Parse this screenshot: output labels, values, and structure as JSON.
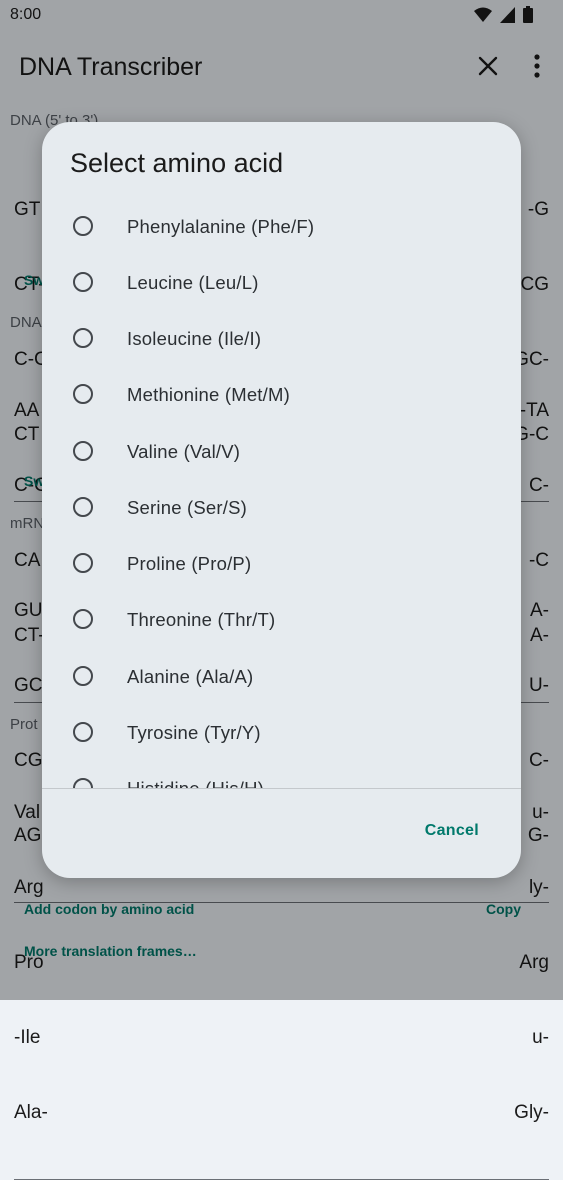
{
  "status_bar": {
    "time": "8:00"
  },
  "app_bar": {
    "title": "DNA Transcriber"
  },
  "sections": [
    {
      "label": "DNA (5' to 3')",
      "lines": [
        [
          "GT",
          "-G"
        ],
        [
          "CT-",
          "CG"
        ],
        [
          "C-C",
          "GC-"
        ],
        [
          "CT",
          "G-C"
        ]
      ],
      "link": "Sw"
    },
    {
      "label": "DNA",
      "lines": [
        [
          "AA",
          "-TA"
        ],
        [
          "C-C",
          "C-"
        ],
        [
          "CA",
          "-C"
        ],
        [
          "CT-",
          "A-"
        ]
      ],
      "link": "Sw"
    },
    {
      "label": "mRN",
      "lines": [
        [
          "GU",
          "A-"
        ],
        [
          "GC",
          "U-"
        ],
        [
          "CG",
          "C-"
        ],
        [
          "AG",
          "G-"
        ]
      ]
    },
    {
      "label": "Prot",
      "lines": [
        [
          "Val",
          "u-"
        ],
        [
          "Arg",
          "ly-"
        ],
        [
          "Pro",
          "Arg"
        ],
        [
          "-Ile",
          "u-"
        ],
        [
          "Ala-",
          "Gly-"
        ]
      ]
    }
  ],
  "actions": {
    "add_codon": "Add codon by amino acid",
    "copy": "Copy",
    "more_frames": "More translation frames…"
  },
  "dialog": {
    "title": "Select amino acid",
    "options": [
      "Phenylalanine (Phe/F)",
      "Leucine (Leu/L)",
      "Isoleucine (Ile/I)",
      "Methionine (Met/M)",
      "Valine (Val/V)",
      "Serine (Ser/S)",
      "Proline (Pro/P)",
      "Threonine (Thr/T)",
      "Alanine (Ala/A)",
      "Tyrosine (Tyr/Y)",
      "Histidine (His/H)"
    ],
    "cancel": "Cancel"
  },
  "colors": {
    "accent": "#00796b",
    "surface": "#e6ebef",
    "background": "#eef2f6"
  },
  "icons": [
    "wifi-icon",
    "signal-icon",
    "battery-icon",
    "close-icon",
    "more-vert-icon"
  ]
}
